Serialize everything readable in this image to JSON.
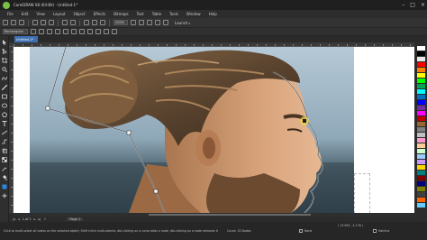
{
  "app": {
    "window_title": "CorelDRAW X8 (64-Bit) - Untitled-1*",
    "accent_color": "#3f6fb0"
  },
  "menu": [
    "File",
    "Edit",
    "View",
    "Layout",
    "Object",
    "Effects",
    "Bitmaps",
    "Text",
    "Table",
    "Tools",
    "Window",
    "Help"
  ],
  "toolbar": {
    "zoom_value": "200%",
    "launch_label": "Launch"
  },
  "property_bar": {
    "preset_value": "Rectangular"
  },
  "document": {
    "tab_label": "Untitled-1*"
  },
  "page_nav": {
    "page_count": "1 of 1",
    "page_tab": "Page 1"
  },
  "status": {
    "hint": "Click to multi-select all nodes on the selected object; Shift+click multi-selects; dbl-clicking on a curve adds a node; dbl-clicking on a node removes it",
    "selection": "Curve: 32 Nodes",
    "fill_label": "None",
    "outline_label": "Hairline",
    "coordinates": "( 13.955 ; 4.178 )"
  },
  "palette_colors": [
    "#ffffff",
    "#000000",
    "#e8e8e8",
    "#ff0000",
    "#ff7f00",
    "#ffff00",
    "#00ff00",
    "#00a651",
    "#00ffff",
    "#0070c0",
    "#0000ff",
    "#7030a0",
    "#ff00ff",
    "#c00000",
    "#996633",
    "#808080",
    "#c0c0c0",
    "#ff99cc",
    "#ffcc99",
    "#ccffcc",
    "#99ccff",
    "#cc99ff",
    "#ffd700",
    "#008080",
    "#800000",
    "#000080",
    "#808000",
    "#404040",
    "#ff6600",
    "#66ccff"
  ]
}
